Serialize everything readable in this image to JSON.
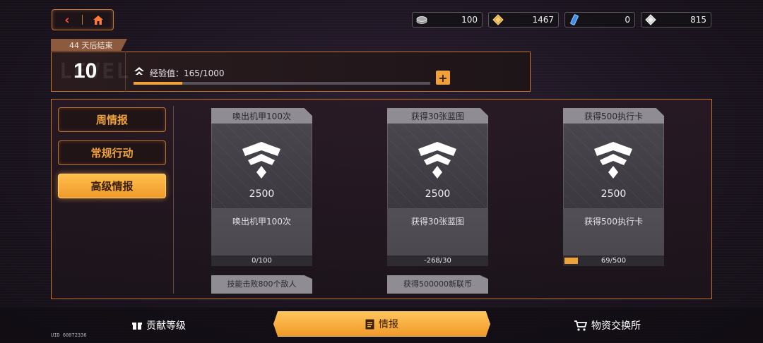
{
  "nav": {
    "back_icon": "back-arrow-icon",
    "home_icon": "home-icon"
  },
  "resources": [
    {
      "icon": "coin-stack-icon",
      "value": "100"
    },
    {
      "icon": "gold-gem-icon",
      "value": "1467"
    },
    {
      "icon": "blue-ticket-icon",
      "value": "0"
    },
    {
      "icon": "silver-gem-icon",
      "value": "815"
    }
  ],
  "season": {
    "end_label": "44 天后结束"
  },
  "level": {
    "ghost_text": "LEVEL",
    "number": "10",
    "exp_label": "经验值：165/1000",
    "exp_current": 165,
    "exp_max": 1000,
    "plus_label": "+"
  },
  "tabs": [
    {
      "label": "周情报"
    },
    {
      "label": "常规行动"
    },
    {
      "label": "高级情报"
    }
  ],
  "cards": [
    {
      "title": "唤出机甲100次",
      "reward": "2500",
      "desc": "唤出机甲100次",
      "progress_text": "0/100",
      "progress_fraction": 0.0
    },
    {
      "title": "获得30张蓝图",
      "reward": "2500",
      "desc": "获得30张蓝图",
      "progress_text": "-268/30",
      "progress_fraction": 0.0
    },
    {
      "title": "获得500执行卡",
      "reward": "2500",
      "desc": "获得500执行卡",
      "progress_text": "69/500",
      "progress_fraction": 0.138
    }
  ],
  "peek_cards": [
    {
      "title": "技能击败800个敌人"
    },
    {
      "title": "获得500000新联币"
    }
  ],
  "bottom_tabs": [
    {
      "label": "贡献等级",
      "icon": "gift-icon"
    },
    {
      "label": "情报",
      "icon": "document-icon"
    },
    {
      "label": "物资交换所",
      "icon": "cart-icon"
    }
  ],
  "uid": "UID 60072336",
  "colors": {
    "accent": "#f0a23a",
    "border": "#c9752f",
    "card": "#56525a"
  }
}
